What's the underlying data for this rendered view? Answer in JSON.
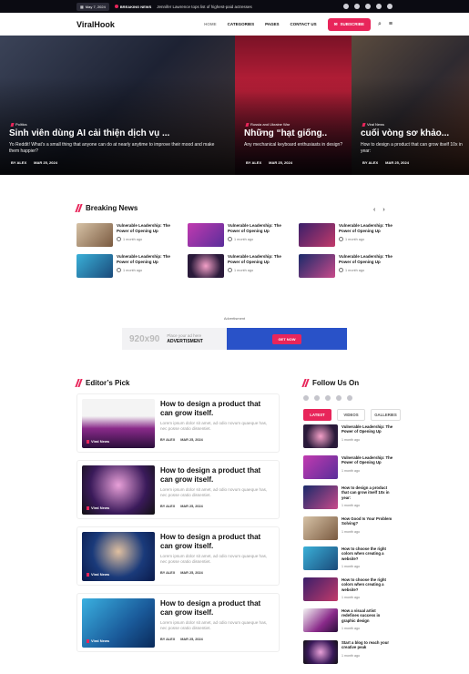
{
  "topbar": {
    "date": "May 7, 2024",
    "breaking_label": "BREAKING NEWS",
    "ticker": "Jennifer Lawrence tops list of highest-paid actresses"
  },
  "nav": {
    "logo": "ViralHook",
    "menu": [
      "HOME",
      "CATEGORIES",
      "PAGES",
      "CONTACT US"
    ],
    "subscribe": "SUBSCRIBE"
  },
  "hero": [
    {
      "category": "Politics",
      "title": "Sinh viên dùng AI cải thiện dịch vụ ...",
      "excerpt": "Yo Reddit! What’s a small thing that anyone can do at nearly anytime to improve their mood and make them happier?",
      "author": "BY ALEX",
      "date": "MAR 25, 2024"
    },
    {
      "category": "Russia and Ukraine War",
      "title": "Những “hạt giống..",
      "excerpt": "Any mechanical keyboard enthusiasts in design?",
      "author": "BY ALEX",
      "date": "MAR 25, 2024"
    },
    {
      "category": "Viral News",
      "title": "cuối vòng sơ khảo...",
      "excerpt": "How to design a product that can grow itself 10x in year:",
      "author": "BY ALEX",
      "date": "MAR 25, 2024"
    }
  ],
  "breaking": {
    "heading": "Breaking News",
    "items": [
      {
        "title": "Vulnerable Leadership: The Power of Opening Up",
        "time": "1 month ago"
      },
      {
        "title": "Vulnerable Leadership: The Power of Opening Up",
        "time": "1 month ago"
      },
      {
        "title": "Vulnerable Leadership: The Power of Opening Up",
        "time": "1 month ago"
      },
      {
        "title": "Vulnerable Leadership: The Power of Opening Up",
        "time": "1 month ago"
      },
      {
        "title": "Vulnerable Leadership: The Power of Opening Up",
        "time": "1 month ago"
      },
      {
        "title": "Vulnerable Leadership: The Power of Opening Up",
        "time": "1 month ago"
      }
    ]
  },
  "ad": {
    "label": "Advertisment",
    "size": "920x90",
    "line1": "Place your ad here",
    "line2": "ADVERTISMENT",
    "cta": "GET NOW"
  },
  "editors": {
    "heading": "Editor’s Pick",
    "items": [
      {
        "category": "Viral News",
        "title": "How to design a product that can grow itself.",
        "excerpt": "Lorem ipsum dolor sit amet, ad odio novum quaeque has, nec posse oratio dissentiet.",
        "author": "BY ALEX",
        "date": "MAR 25, 2024"
      },
      {
        "category": "Viral News",
        "title": "How to design a product that can grow itself.",
        "excerpt": "Lorem ipsum dolor sit amet, ad odio novum quaeque has, nec posse oratio dissentiet.",
        "author": "BY ALEX",
        "date": "MAR 25, 2024"
      },
      {
        "category": "Viral News",
        "title": "How to design a product that can grow itself.",
        "excerpt": "Lorem ipsum dolor sit amet, ad odio novum quaeque has, nec posse oratio dissentiet.",
        "author": "BY ALEX",
        "date": "MAR 25, 2024"
      },
      {
        "category": "Viral News",
        "title": "How to design a product that can grow itself.",
        "excerpt": "Lorem ipsum dolor sit amet, ad odio novum quaeque has, nec posse oratio dissentiet.",
        "author": "BY ALEX",
        "date": "MAR 25, 2024"
      }
    ]
  },
  "follow": {
    "heading": "Follow Us On",
    "tabs": [
      "LATEST",
      "VIDEOS",
      "GALLERIES"
    ],
    "items": [
      {
        "title": "Vulnerable Leadership: The Power of Opening Up",
        "time": "1 month ago"
      },
      {
        "title": "Vulnerable Leadership: The Power of Opening Up",
        "time": "1 month ago"
      },
      {
        "title": "How to design a product that can grow itself 10x in year:",
        "time": "1 month ago"
      },
      {
        "title": "How Good Is Your Problem Solving?",
        "time": "1 month ago"
      },
      {
        "title": "How to choose the right colors when creating a website?",
        "time": "1 month ago"
      },
      {
        "title": "How to choose the right colors when creating a website?",
        "time": "1 month ago"
      },
      {
        "title": "How a visual artist redefines success in graphic design",
        "time": "1 month ago"
      },
      {
        "title": "Start a blog to reach your creative peak",
        "time": "1 month ago"
      }
    ]
  }
}
